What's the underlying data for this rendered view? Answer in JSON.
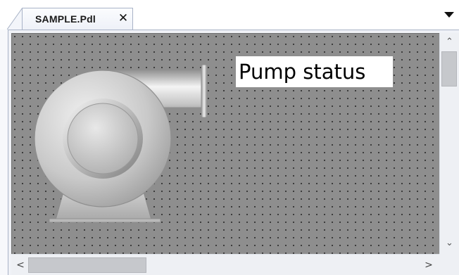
{
  "tab": {
    "title": "SAMPLE.Pdl",
    "close_glyph": "✕"
  },
  "icons": {
    "tab_close": "close-icon",
    "tab_dropdown": "triangle-down-icon",
    "scroll_up": "chevron-up-icon",
    "scroll_down": "chevron-down-icon",
    "scroll_left": "chevron-left-icon",
    "scroll_right": "chevron-right-icon"
  },
  "glyphs": {
    "up": "⌃",
    "down": "⌄",
    "left": "<",
    "right": ">"
  },
  "canvas": {
    "background_color": "#8e8e8e",
    "grid_dot_color": "#2f2f2f",
    "objects": {
      "pump": {
        "object_type": "pump graphic"
      },
      "status_label": {
        "text": "Pump status",
        "background": "#ffffff"
      }
    }
  },
  "colors": {
    "tab_border": "#a9b3c7",
    "scroll_track": "#eef0f4",
    "scroll_thumb": "#c6c8cc"
  }
}
